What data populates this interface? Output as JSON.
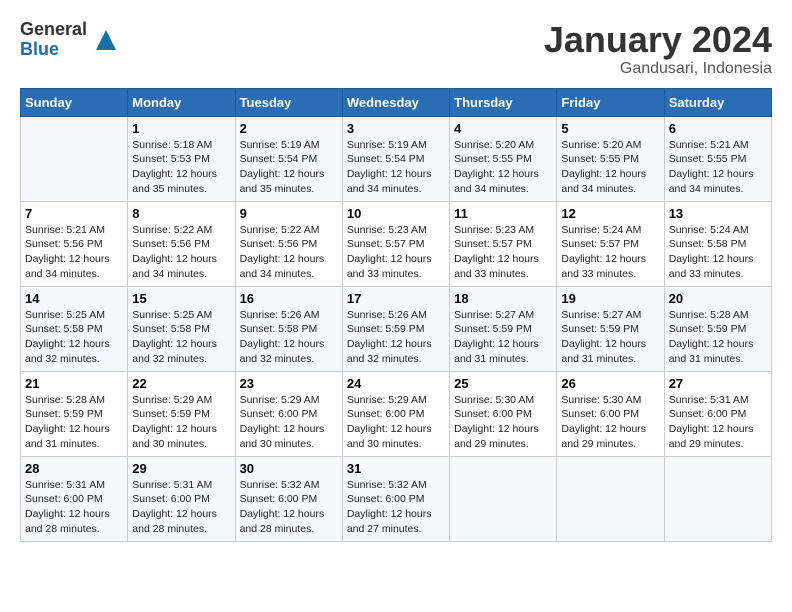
{
  "header": {
    "logo_general": "General",
    "logo_blue": "Blue",
    "month_title": "January 2024",
    "location": "Gandusari, Indonesia"
  },
  "weekdays": [
    "Sunday",
    "Monday",
    "Tuesday",
    "Wednesday",
    "Thursday",
    "Friday",
    "Saturday"
  ],
  "weeks": [
    [
      {
        "day": "",
        "text": ""
      },
      {
        "day": "1",
        "text": "Sunrise: 5:18 AM\nSunset: 5:53 PM\nDaylight: 12 hours\nand 35 minutes."
      },
      {
        "day": "2",
        "text": "Sunrise: 5:19 AM\nSunset: 5:54 PM\nDaylight: 12 hours\nand 35 minutes."
      },
      {
        "day": "3",
        "text": "Sunrise: 5:19 AM\nSunset: 5:54 PM\nDaylight: 12 hours\nand 34 minutes."
      },
      {
        "day": "4",
        "text": "Sunrise: 5:20 AM\nSunset: 5:55 PM\nDaylight: 12 hours\nand 34 minutes."
      },
      {
        "day": "5",
        "text": "Sunrise: 5:20 AM\nSunset: 5:55 PM\nDaylight: 12 hours\nand 34 minutes."
      },
      {
        "day": "6",
        "text": "Sunrise: 5:21 AM\nSunset: 5:55 PM\nDaylight: 12 hours\nand 34 minutes."
      }
    ],
    [
      {
        "day": "7",
        "text": "Sunrise: 5:21 AM\nSunset: 5:56 PM\nDaylight: 12 hours\nand 34 minutes."
      },
      {
        "day": "8",
        "text": "Sunrise: 5:22 AM\nSunset: 5:56 PM\nDaylight: 12 hours\nand 34 minutes."
      },
      {
        "day": "9",
        "text": "Sunrise: 5:22 AM\nSunset: 5:56 PM\nDaylight: 12 hours\nand 34 minutes."
      },
      {
        "day": "10",
        "text": "Sunrise: 5:23 AM\nSunset: 5:57 PM\nDaylight: 12 hours\nand 33 minutes."
      },
      {
        "day": "11",
        "text": "Sunrise: 5:23 AM\nSunset: 5:57 PM\nDaylight: 12 hours\nand 33 minutes."
      },
      {
        "day": "12",
        "text": "Sunrise: 5:24 AM\nSunset: 5:57 PM\nDaylight: 12 hours\nand 33 minutes."
      },
      {
        "day": "13",
        "text": "Sunrise: 5:24 AM\nSunset: 5:58 PM\nDaylight: 12 hours\nand 33 minutes."
      }
    ],
    [
      {
        "day": "14",
        "text": "Sunrise: 5:25 AM\nSunset: 5:58 PM\nDaylight: 12 hours\nand 32 minutes."
      },
      {
        "day": "15",
        "text": "Sunrise: 5:25 AM\nSunset: 5:58 PM\nDaylight: 12 hours\nand 32 minutes."
      },
      {
        "day": "16",
        "text": "Sunrise: 5:26 AM\nSunset: 5:58 PM\nDaylight: 12 hours\nand 32 minutes."
      },
      {
        "day": "17",
        "text": "Sunrise: 5:26 AM\nSunset: 5:59 PM\nDaylight: 12 hours\nand 32 minutes."
      },
      {
        "day": "18",
        "text": "Sunrise: 5:27 AM\nSunset: 5:59 PM\nDaylight: 12 hours\nand 31 minutes."
      },
      {
        "day": "19",
        "text": "Sunrise: 5:27 AM\nSunset: 5:59 PM\nDaylight: 12 hours\nand 31 minutes."
      },
      {
        "day": "20",
        "text": "Sunrise: 5:28 AM\nSunset: 5:59 PM\nDaylight: 12 hours\nand 31 minutes."
      }
    ],
    [
      {
        "day": "21",
        "text": "Sunrise: 5:28 AM\nSunset: 5:59 PM\nDaylight: 12 hours\nand 31 minutes."
      },
      {
        "day": "22",
        "text": "Sunrise: 5:29 AM\nSunset: 5:59 PM\nDaylight: 12 hours\nand 30 minutes."
      },
      {
        "day": "23",
        "text": "Sunrise: 5:29 AM\nSunset: 6:00 PM\nDaylight: 12 hours\nand 30 minutes."
      },
      {
        "day": "24",
        "text": "Sunrise: 5:29 AM\nSunset: 6:00 PM\nDaylight: 12 hours\nand 30 minutes."
      },
      {
        "day": "25",
        "text": "Sunrise: 5:30 AM\nSunset: 6:00 PM\nDaylight: 12 hours\nand 29 minutes."
      },
      {
        "day": "26",
        "text": "Sunrise: 5:30 AM\nSunset: 6:00 PM\nDaylight: 12 hours\nand 29 minutes."
      },
      {
        "day": "27",
        "text": "Sunrise: 5:31 AM\nSunset: 6:00 PM\nDaylight: 12 hours\nand 29 minutes."
      }
    ],
    [
      {
        "day": "28",
        "text": "Sunrise: 5:31 AM\nSunset: 6:00 PM\nDaylight: 12 hours\nand 28 minutes."
      },
      {
        "day": "29",
        "text": "Sunrise: 5:31 AM\nSunset: 6:00 PM\nDaylight: 12 hours\nand 28 minutes."
      },
      {
        "day": "30",
        "text": "Sunrise: 5:32 AM\nSunset: 6:00 PM\nDaylight: 12 hours\nand 28 minutes."
      },
      {
        "day": "31",
        "text": "Sunrise: 5:32 AM\nSunset: 6:00 PM\nDaylight: 12 hours\nand 27 minutes."
      },
      {
        "day": "",
        "text": ""
      },
      {
        "day": "",
        "text": ""
      },
      {
        "day": "",
        "text": ""
      }
    ]
  ]
}
